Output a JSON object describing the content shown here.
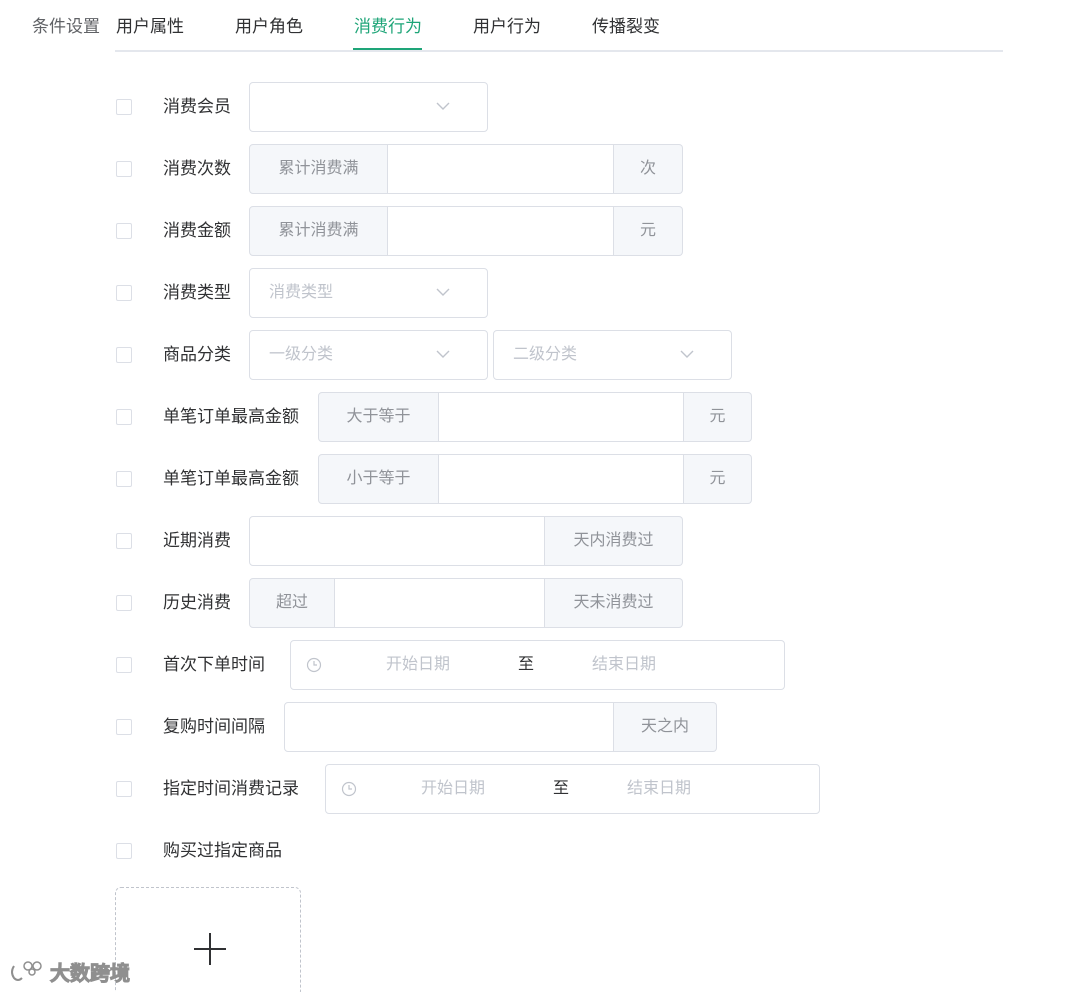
{
  "header": {
    "section_label": "条件设置",
    "tabs": [
      {
        "label": "用户属性"
      },
      {
        "label": "用户角色"
      },
      {
        "label": "消费行为",
        "active": true
      },
      {
        "label": "用户行为"
      },
      {
        "label": "传播裂变"
      }
    ],
    "active_color": "#1ea578"
  },
  "rows": {
    "member": {
      "label": "消费会员",
      "placeholder": ""
    },
    "count": {
      "label": "消费次数",
      "prefix": "累计消费满",
      "suffix": "次"
    },
    "amount": {
      "label": "消费金额",
      "prefix": "累计消费满",
      "suffix": "元"
    },
    "type": {
      "label": "消费类型",
      "placeholder": "消费类型"
    },
    "category": {
      "label": "商品分类",
      "placeholder1": "一级分类",
      "placeholder2": "二级分类"
    },
    "max_gte": {
      "label": "单笔订单最高金额",
      "prefix": "大于等于",
      "suffix": "元"
    },
    "max_lte": {
      "label": "单笔订单最高金额",
      "prefix": "小于等于",
      "suffix": "元"
    },
    "recent": {
      "label": "近期消费",
      "suffix": "天内消费过"
    },
    "history": {
      "label": "历史消费",
      "prefix": "超过",
      "suffix": "天未消费过"
    },
    "first_order": {
      "label": "首次下单时间",
      "start": "开始日期",
      "sep": "至",
      "end": "结束日期"
    },
    "repurchase": {
      "label": "复购时间间隔",
      "suffix": "天之内"
    },
    "period_record": {
      "label": "指定时间消费记录",
      "start": "开始日期",
      "sep": "至",
      "end": "结束日期"
    },
    "bought_product": {
      "label": "购买过指定商品"
    }
  },
  "upload": {
    "icon": "plus-icon"
  },
  "watermark": {
    "text": "大数跨境"
  }
}
